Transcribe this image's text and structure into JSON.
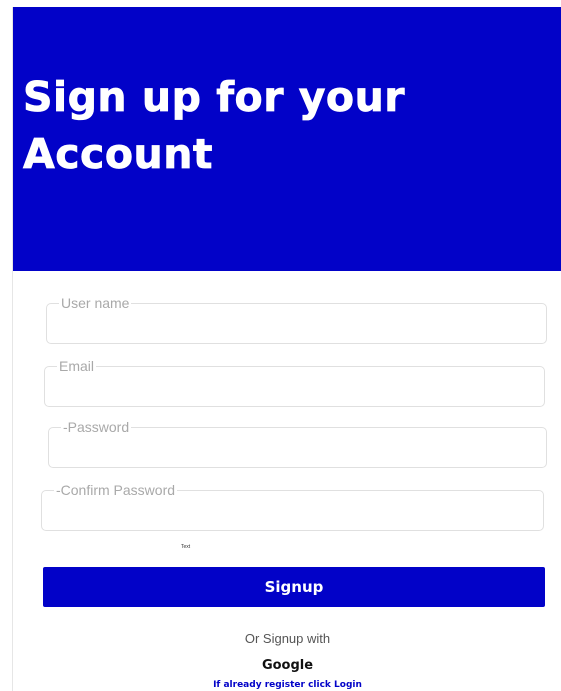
{
  "header": {
    "title": "Sign up for your Account"
  },
  "form": {
    "username": {
      "label": "User name",
      "value": ""
    },
    "email": {
      "label": "Email",
      "value": ""
    },
    "password": {
      "label": "-Password",
      "value": ""
    },
    "confirm_password": {
      "label": "-Confirm Password",
      "value": ""
    },
    "small_text": "Text",
    "signup_label": "Signup"
  },
  "alternatives": {
    "or_text": "Or Signup with",
    "google_label": "Google",
    "login_text": "If already register click Login"
  },
  "colors": {
    "primary": "#0202c8",
    "background": "#ffffff",
    "label": "#a9a9a9"
  }
}
